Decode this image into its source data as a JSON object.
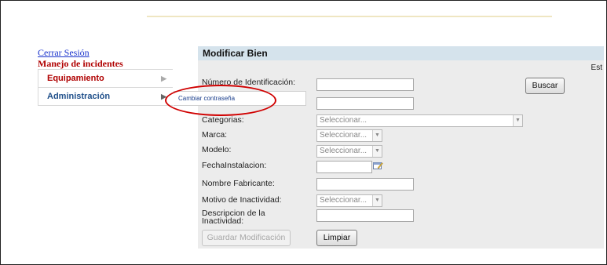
{
  "nav": {
    "logout_label": "Cerrar Sesión",
    "section_title": "Manejo de incidentes",
    "items": [
      {
        "label": "Equipamiento"
      },
      {
        "label": "Administración"
      }
    ],
    "submenu_item": "Cambiar contraseña"
  },
  "form": {
    "title": "Modificar Bien",
    "status_fragment": "Est",
    "id_label": "Número de Identificación:",
    "search_button": "Buscar",
    "categories_label": "Categorias:",
    "categories_value": "Seleccionar...",
    "brand_label": "Marca:",
    "brand_value": "Seleccionar...",
    "model_label": "Modelo:",
    "model_value": "Seleccionar...",
    "install_date_label": "FechaInstalacion:",
    "manufacturer_label": "Nombre Fabricante:",
    "inactivity_reason_label": "Motivo de Inactividad:",
    "inactivity_reason_value": "Seleccionar...",
    "inactivity_desc_label_1": "Descripcion de la",
    "inactivity_desc_label_2": "Inactividad:",
    "save_button": "Guardar Modificación",
    "clear_button": "Limpiar"
  },
  "annotation": {
    "color": "#d00000"
  }
}
